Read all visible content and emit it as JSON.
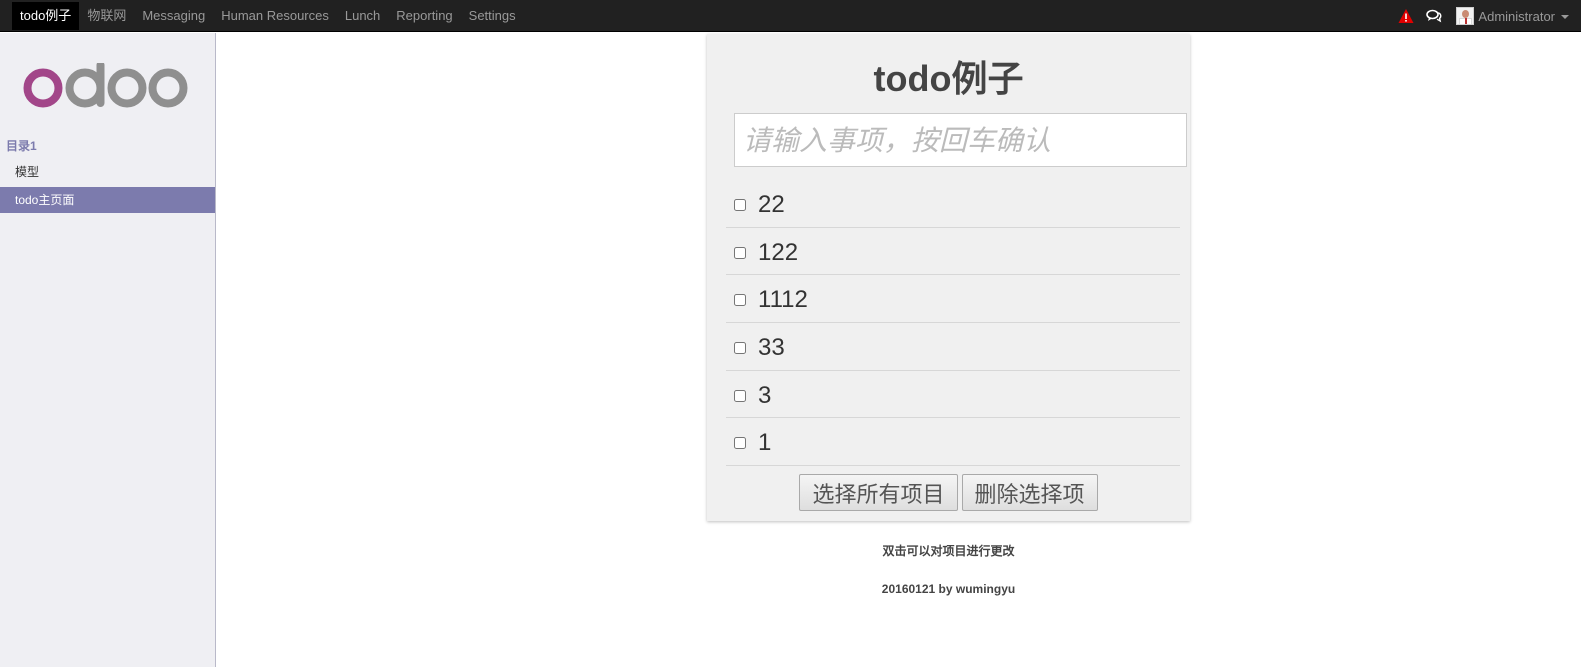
{
  "topbar": {
    "menu": [
      "todo例子",
      "物联网",
      "Messaging",
      "Human Resources",
      "Lunch",
      "Reporting",
      "Settings"
    ],
    "active": "todo例子",
    "user": "Administrator",
    "icons": [
      "warning-icon",
      "chat-icon",
      "avatar",
      "caret-down-icon"
    ],
    "warning_color": "#e00000"
  },
  "sidebar": {
    "section": "目录1",
    "items": [
      "模型",
      "todo主页面"
    ],
    "active": "todo主页面",
    "accent": "#7c7bad"
  },
  "logo": {
    "text": "odoo",
    "accent_color": "#a24689",
    "gray_color": "#8f8f8f"
  },
  "todo": {
    "title": "todo例子",
    "input_placeholder": "请输入事项，按回车确认",
    "input_value": "",
    "items": [
      {
        "text": "22",
        "checked": false
      },
      {
        "text": "122",
        "checked": false
      },
      {
        "text": "1112",
        "checked": false
      },
      {
        "text": "33",
        "checked": false
      },
      {
        "text": "3",
        "checked": false
      },
      {
        "text": "1",
        "checked": false
      }
    ],
    "select_all_label": "选择所有项目",
    "delete_selected_label": "删除选择项"
  },
  "footer": {
    "hint": "双击可以对项目进行更改",
    "credit": "20160121 by wumingyu"
  }
}
